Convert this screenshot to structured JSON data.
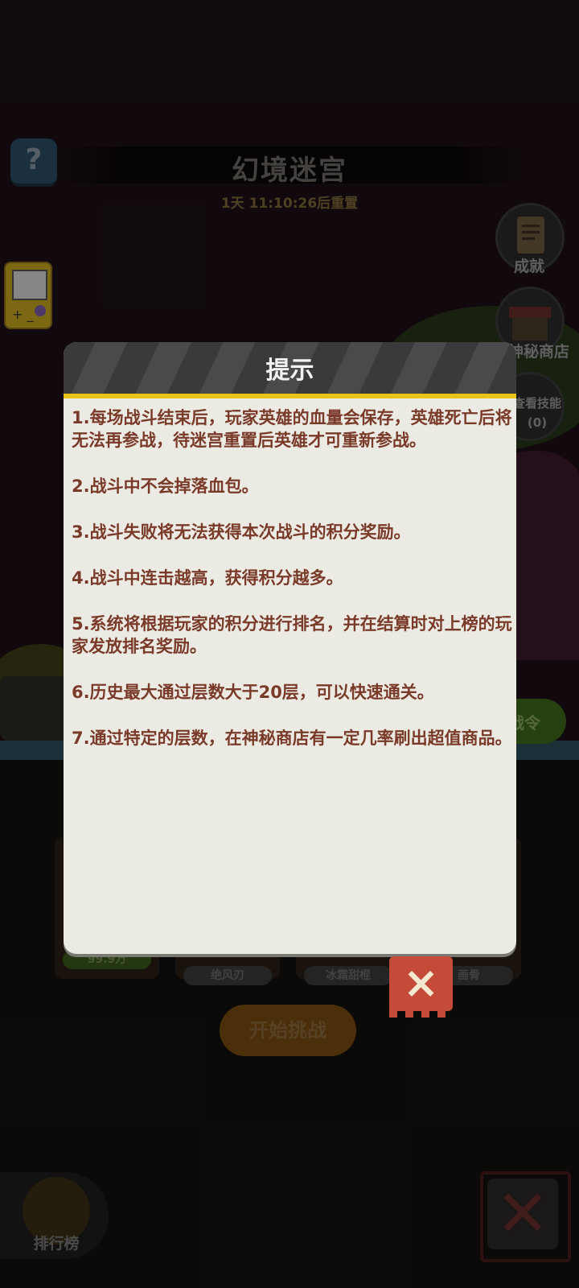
{
  "header": {
    "help_icon_text": "?",
    "title": "幻境迷宫",
    "reset_timer": "1天 11:10:26后重置"
  },
  "side_menu": {
    "achievements_label": "成就",
    "shop_label": "神秘商店",
    "skills_label": "查看技能",
    "skills_count": "(0)",
    "battle_pass_label": "战令"
  },
  "hero_slots": [
    {
      "tag": "99.9万"
    },
    {
      "tag": "绝风刃"
    },
    {
      "tag": "冰霜甜棍"
    },
    {
      "tag": "画骨"
    }
  ],
  "start_button_label": "开始挑战",
  "leaderboard_label": "排行榜",
  "dialog": {
    "title": "提示",
    "tips": [
      "1.每场战斗结束后，玩家英雄的血量会保存，英雄死亡后将无法再参战，待迷宫重置后英雄才可重新参战。",
      "2.战斗中不会掉落血包。",
      "3.战斗失败将无法获得本次战斗的积分奖励。",
      "4.战斗中连击越高，获得积分越多。",
      "5.系统将根据玩家的积分进行排名，并在结算时对上榜的玩家发放排名奖励。",
      "6.历史最大通过层数大于20层，可以快速通关。",
      "7.通过特定的层数，在神秘商店有一定几率刷出超值商品。"
    ],
    "close_icon": "×"
  },
  "colors": {
    "dialog_bg": "#ecebe3",
    "dialog_header": "#3e3e40",
    "header_accent": "#e8c41a",
    "tip_text": "#7a3a2a",
    "close_tag": "#c44a3a"
  }
}
